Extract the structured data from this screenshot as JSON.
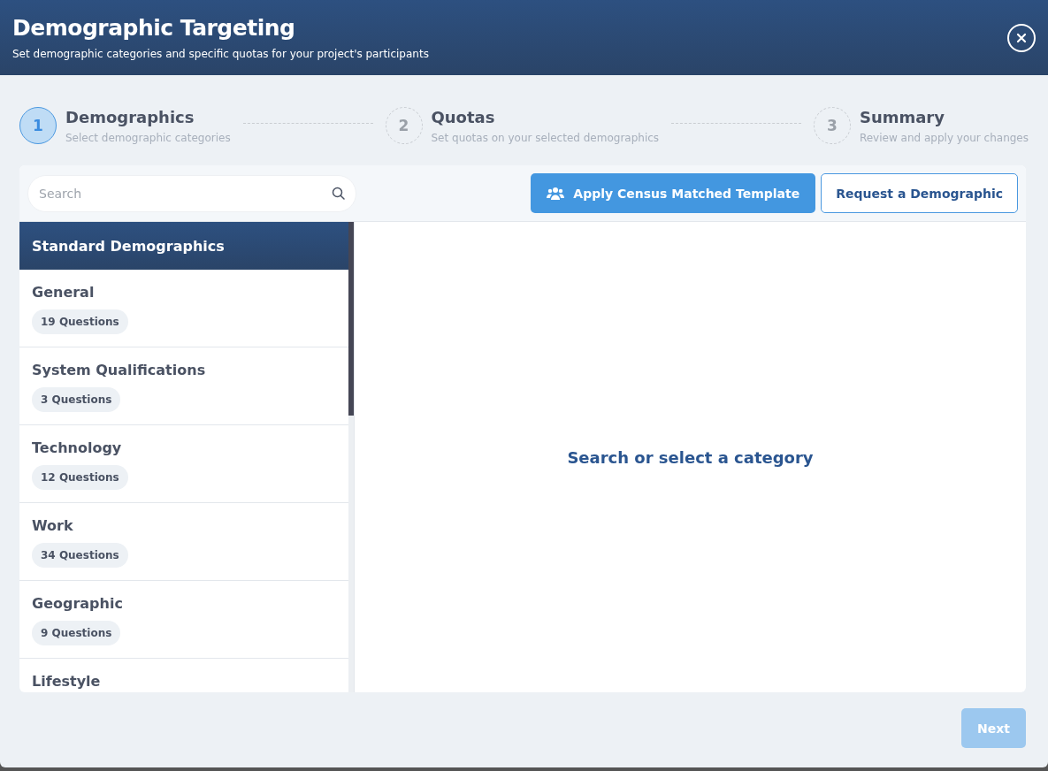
{
  "header": {
    "title": "Demographic Targeting",
    "subtitle": "Set demographic categories and specific quotas for your project's participants"
  },
  "steps": [
    {
      "number": "1",
      "title": "Demographics",
      "description": "Select demographic categories",
      "active": true
    },
    {
      "number": "2",
      "title": "Quotas",
      "description": "Set quotas on your selected demographics",
      "active": false
    },
    {
      "number": "3",
      "title": "Summary",
      "description": "Review and apply your changes",
      "active": false
    }
  ],
  "search": {
    "placeholder": "Search"
  },
  "buttons": {
    "template": "Apply Census Matched Template",
    "request": "Request a Demographic",
    "next": "Next",
    "next_disabled": true
  },
  "sidebar": {
    "heading": "Standard Demographics",
    "items": [
      {
        "name": "General",
        "count": "19 Questions"
      },
      {
        "name": "System Qualifications",
        "count": "3 Questions"
      },
      {
        "name": "Technology",
        "count": "12 Questions"
      },
      {
        "name": "Work",
        "count": "34 Questions"
      },
      {
        "name": "Geographic",
        "count": "9 Questions"
      },
      {
        "name": "Lifestyle"
      }
    ]
  },
  "empty_message": "Search or select a category"
}
